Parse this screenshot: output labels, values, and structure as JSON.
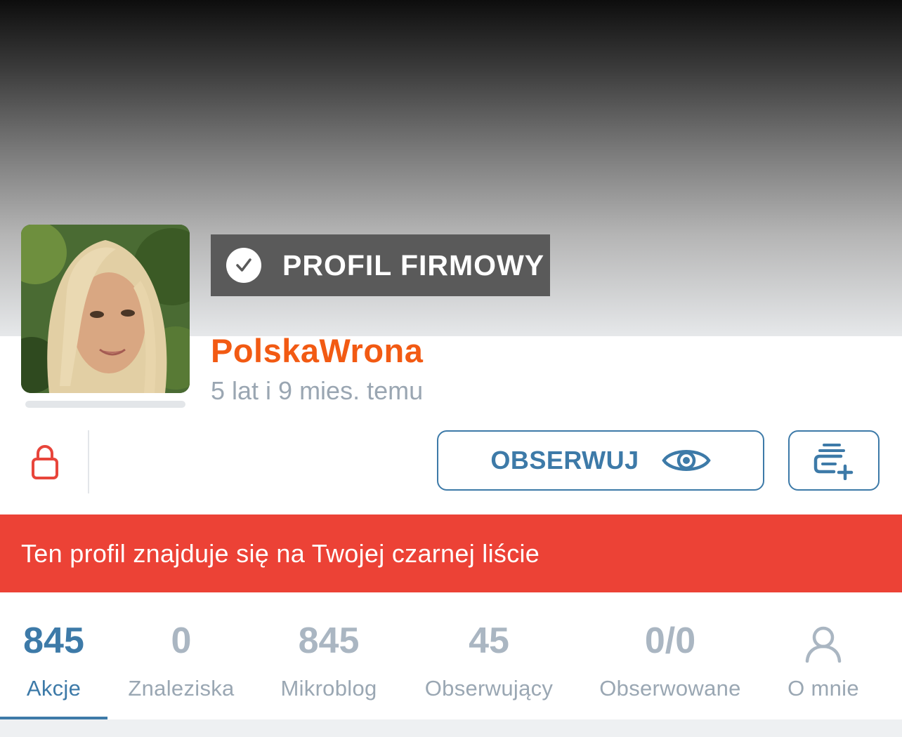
{
  "profile": {
    "badge_label": "PROFIL FIRMOWY",
    "username": "PolskaWrona",
    "joined": "5 lat i 9 mies. temu"
  },
  "actions": {
    "follow_label": "OBSERWUJ"
  },
  "notice": {
    "blacklist_text": "Ten profil znajduje się na Twojej czarnej liście"
  },
  "tabs": [
    {
      "value": "845",
      "label": "Akcje",
      "active": true
    },
    {
      "value": "0",
      "label": "Znaleziska",
      "active": false
    },
    {
      "value": "845",
      "label": "Mikroblog",
      "active": false
    },
    {
      "value": "45",
      "label": "Obserwujący",
      "active": false
    },
    {
      "value": "0/0",
      "label": "Obserwowane",
      "active": false
    },
    {
      "value": "",
      "label": "O mnie",
      "active": false,
      "icon": "user-icon"
    }
  ],
  "colors": {
    "username": "#f25a13",
    "accent": "#3d7aa8",
    "blacklist_bg": "#ec4236",
    "lock": "#e8453b",
    "tab_inactive": "#aab6c2"
  },
  "icons": {
    "badge": "check-circle-icon",
    "lock": "lock-icon",
    "follow": "eye-icon",
    "add_list": "add-to-list-icon",
    "about": "user-icon"
  }
}
